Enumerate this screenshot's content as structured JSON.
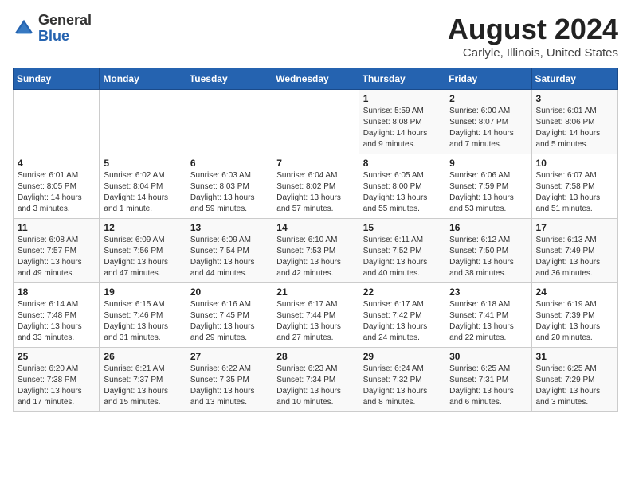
{
  "header": {
    "logo_line1": "General",
    "logo_line2": "Blue",
    "main_title": "August 2024",
    "subtitle": "Carlyle, Illinois, United States"
  },
  "days_of_week": [
    "Sunday",
    "Monday",
    "Tuesday",
    "Wednesday",
    "Thursday",
    "Friday",
    "Saturday"
  ],
  "weeks": [
    [
      {
        "day": "",
        "info": ""
      },
      {
        "day": "",
        "info": ""
      },
      {
        "day": "",
        "info": ""
      },
      {
        "day": "",
        "info": ""
      },
      {
        "day": "1",
        "info": "Sunrise: 5:59 AM\nSunset: 8:08 PM\nDaylight: 14 hours\nand 9 minutes."
      },
      {
        "day": "2",
        "info": "Sunrise: 6:00 AM\nSunset: 8:07 PM\nDaylight: 14 hours\nand 7 minutes."
      },
      {
        "day": "3",
        "info": "Sunrise: 6:01 AM\nSunset: 8:06 PM\nDaylight: 14 hours\nand 5 minutes."
      }
    ],
    [
      {
        "day": "4",
        "info": "Sunrise: 6:01 AM\nSunset: 8:05 PM\nDaylight: 14 hours\nand 3 minutes."
      },
      {
        "day": "5",
        "info": "Sunrise: 6:02 AM\nSunset: 8:04 PM\nDaylight: 14 hours\nand 1 minute."
      },
      {
        "day": "6",
        "info": "Sunrise: 6:03 AM\nSunset: 8:03 PM\nDaylight: 13 hours\nand 59 minutes."
      },
      {
        "day": "7",
        "info": "Sunrise: 6:04 AM\nSunset: 8:02 PM\nDaylight: 13 hours\nand 57 minutes."
      },
      {
        "day": "8",
        "info": "Sunrise: 6:05 AM\nSunset: 8:00 PM\nDaylight: 13 hours\nand 55 minutes."
      },
      {
        "day": "9",
        "info": "Sunrise: 6:06 AM\nSunset: 7:59 PM\nDaylight: 13 hours\nand 53 minutes."
      },
      {
        "day": "10",
        "info": "Sunrise: 6:07 AM\nSunset: 7:58 PM\nDaylight: 13 hours\nand 51 minutes."
      }
    ],
    [
      {
        "day": "11",
        "info": "Sunrise: 6:08 AM\nSunset: 7:57 PM\nDaylight: 13 hours\nand 49 minutes."
      },
      {
        "day": "12",
        "info": "Sunrise: 6:09 AM\nSunset: 7:56 PM\nDaylight: 13 hours\nand 47 minutes."
      },
      {
        "day": "13",
        "info": "Sunrise: 6:09 AM\nSunset: 7:54 PM\nDaylight: 13 hours\nand 44 minutes."
      },
      {
        "day": "14",
        "info": "Sunrise: 6:10 AM\nSunset: 7:53 PM\nDaylight: 13 hours\nand 42 minutes."
      },
      {
        "day": "15",
        "info": "Sunrise: 6:11 AM\nSunset: 7:52 PM\nDaylight: 13 hours\nand 40 minutes."
      },
      {
        "day": "16",
        "info": "Sunrise: 6:12 AM\nSunset: 7:50 PM\nDaylight: 13 hours\nand 38 minutes."
      },
      {
        "day": "17",
        "info": "Sunrise: 6:13 AM\nSunset: 7:49 PM\nDaylight: 13 hours\nand 36 minutes."
      }
    ],
    [
      {
        "day": "18",
        "info": "Sunrise: 6:14 AM\nSunset: 7:48 PM\nDaylight: 13 hours\nand 33 minutes."
      },
      {
        "day": "19",
        "info": "Sunrise: 6:15 AM\nSunset: 7:46 PM\nDaylight: 13 hours\nand 31 minutes."
      },
      {
        "day": "20",
        "info": "Sunrise: 6:16 AM\nSunset: 7:45 PM\nDaylight: 13 hours\nand 29 minutes."
      },
      {
        "day": "21",
        "info": "Sunrise: 6:17 AM\nSunset: 7:44 PM\nDaylight: 13 hours\nand 27 minutes."
      },
      {
        "day": "22",
        "info": "Sunrise: 6:17 AM\nSunset: 7:42 PM\nDaylight: 13 hours\nand 24 minutes."
      },
      {
        "day": "23",
        "info": "Sunrise: 6:18 AM\nSunset: 7:41 PM\nDaylight: 13 hours\nand 22 minutes."
      },
      {
        "day": "24",
        "info": "Sunrise: 6:19 AM\nSunset: 7:39 PM\nDaylight: 13 hours\nand 20 minutes."
      }
    ],
    [
      {
        "day": "25",
        "info": "Sunrise: 6:20 AM\nSunset: 7:38 PM\nDaylight: 13 hours\nand 17 minutes."
      },
      {
        "day": "26",
        "info": "Sunrise: 6:21 AM\nSunset: 7:37 PM\nDaylight: 13 hours\nand 15 minutes."
      },
      {
        "day": "27",
        "info": "Sunrise: 6:22 AM\nSunset: 7:35 PM\nDaylight: 13 hours\nand 13 minutes."
      },
      {
        "day": "28",
        "info": "Sunrise: 6:23 AM\nSunset: 7:34 PM\nDaylight: 13 hours\nand 10 minutes."
      },
      {
        "day": "29",
        "info": "Sunrise: 6:24 AM\nSunset: 7:32 PM\nDaylight: 13 hours\nand 8 minutes."
      },
      {
        "day": "30",
        "info": "Sunrise: 6:25 AM\nSunset: 7:31 PM\nDaylight: 13 hours\nand 6 minutes."
      },
      {
        "day": "31",
        "info": "Sunrise: 6:25 AM\nSunset: 7:29 PM\nDaylight: 13 hours\nand 3 minutes."
      }
    ]
  ]
}
